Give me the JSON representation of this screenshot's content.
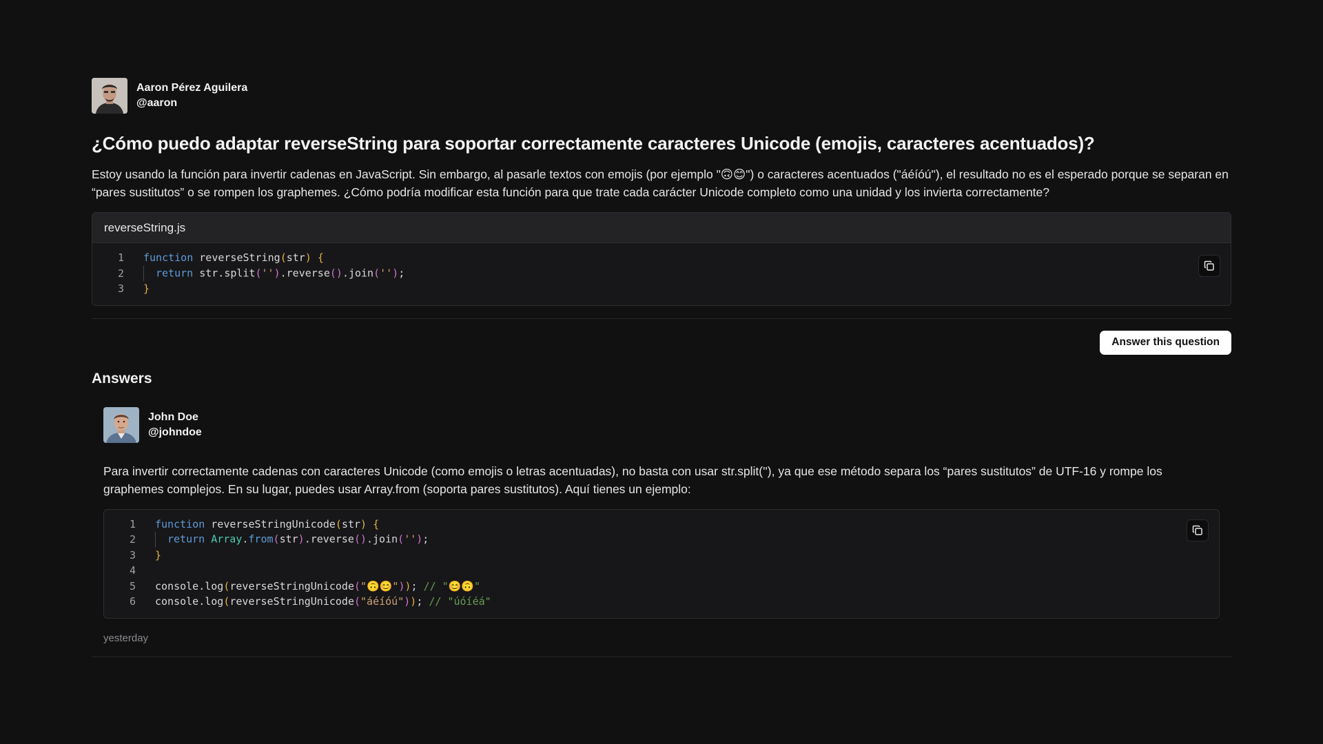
{
  "question": {
    "author": {
      "name": "Aaron Pérez Aguilera",
      "handle": "@aaron"
    },
    "title": "¿Cómo puedo adaptar reverseString para soportar correctamente caracteres Unicode (emojis, caracteres acentuados)?",
    "body": "Estoy usando la función para invertir cadenas en JavaScript. Sin embargo, al pasarle textos con emojis (por ejemplo \"🙃😊\") o caracteres acentuados (\"áéíóú\"), el resultado no es el esperado porque se separan en “pares sustitutos” o se rompen los graphemes. ¿Cómo podría modificar esta función para que trate cada carácter Unicode completo como una unidad y los invierta correctamente?",
    "code": {
      "filename": "reverseString.js",
      "line_numbers": [
        "1",
        "2",
        "3"
      ],
      "tokens": {
        "l1_kw": "function",
        "l1_fn": " reverseString",
        "l1_po": "(",
        "l1_arg": "str",
        "l1_pc": ")",
        "l1_sp": " ",
        "l1_br": "{",
        "l2_kw": "return",
        "l2_a": " str.split",
        "l2_po": "(",
        "l2_s": "''",
        "l2_pc": ")",
        "l2_b": ".reverse",
        "l2_p2": "()",
        "l2_c": ".join",
        "l2_po2": "(",
        "l2_s2": "''",
        "l2_pc2": ")",
        "l2_end": ";",
        "l3_br": "}"
      }
    }
  },
  "answer_button": "Answer this question",
  "answers_heading": "Answers",
  "answer": {
    "author": {
      "name": "John Doe",
      "handle": "@johndoe"
    },
    "body": "Para invertir correctamente cadenas con caracteres Unicode (como emojis o letras acentuadas), no basta con usar str.split(''), ya que ese método separa los “pares sustitutos” de UTF-16 y rompe los graphemes complejos. En su lugar, puedes usar Array.from (soporta pares sustitutos). Aquí tienes un ejemplo:",
    "code": {
      "line_numbers": [
        "1",
        "2",
        "3",
        "4",
        "5",
        "6"
      ],
      "tokens": {
        "l1_kw": "function",
        "l1_fn": " reverseStringUnicode",
        "l1_po": "(",
        "l1_arg": "str",
        "l1_pc": ")",
        "l1_sp": " ",
        "l1_br": "{",
        "l2_kw": "return",
        "l2_cls": " Array",
        "l2_dot": ".",
        "l2_from": "from",
        "l2_po": "(",
        "l2_arg": "str",
        "l2_pc": ")",
        "l2_b": ".reverse",
        "l2_p2": "()",
        "l2_c": ".join",
        "l2_po2": "(",
        "l2_s2": "''",
        "l2_pc2": ")",
        "l2_end": ";",
        "l3_br": "}",
        "l5_a": "console.log",
        "l5_po": "(",
        "l5_b": "reverseStringUnicode",
        "l5_po2": "(",
        "l5_s": "\"🙃😊\"",
        "l5_pc2": ")",
        "l5_pc": ")",
        "l5_end": "; ",
        "l5_c": "// \"😊🙃\"",
        "l6_a": "console.log",
        "l6_po": "(",
        "l6_b": "reverseStringUnicode",
        "l6_po2": "(",
        "l6_s": "\"áéíóú\"",
        "l6_pc2": ")",
        "l6_pc": ")",
        "l6_end": "; ",
        "l6_c": "// \"úóíéá\""
      }
    },
    "timestamp": "yesterday"
  },
  "icons": {
    "copy": "copy-icon"
  },
  "colors": {
    "background": "#111112",
    "keyword": "#5d9bd8",
    "string": "#d1a271",
    "comment": "#6a9a52",
    "paren_yellow": "#e3b341",
    "paren_pink": "#d272c8",
    "paren_blue": "#4f9ee0"
  }
}
